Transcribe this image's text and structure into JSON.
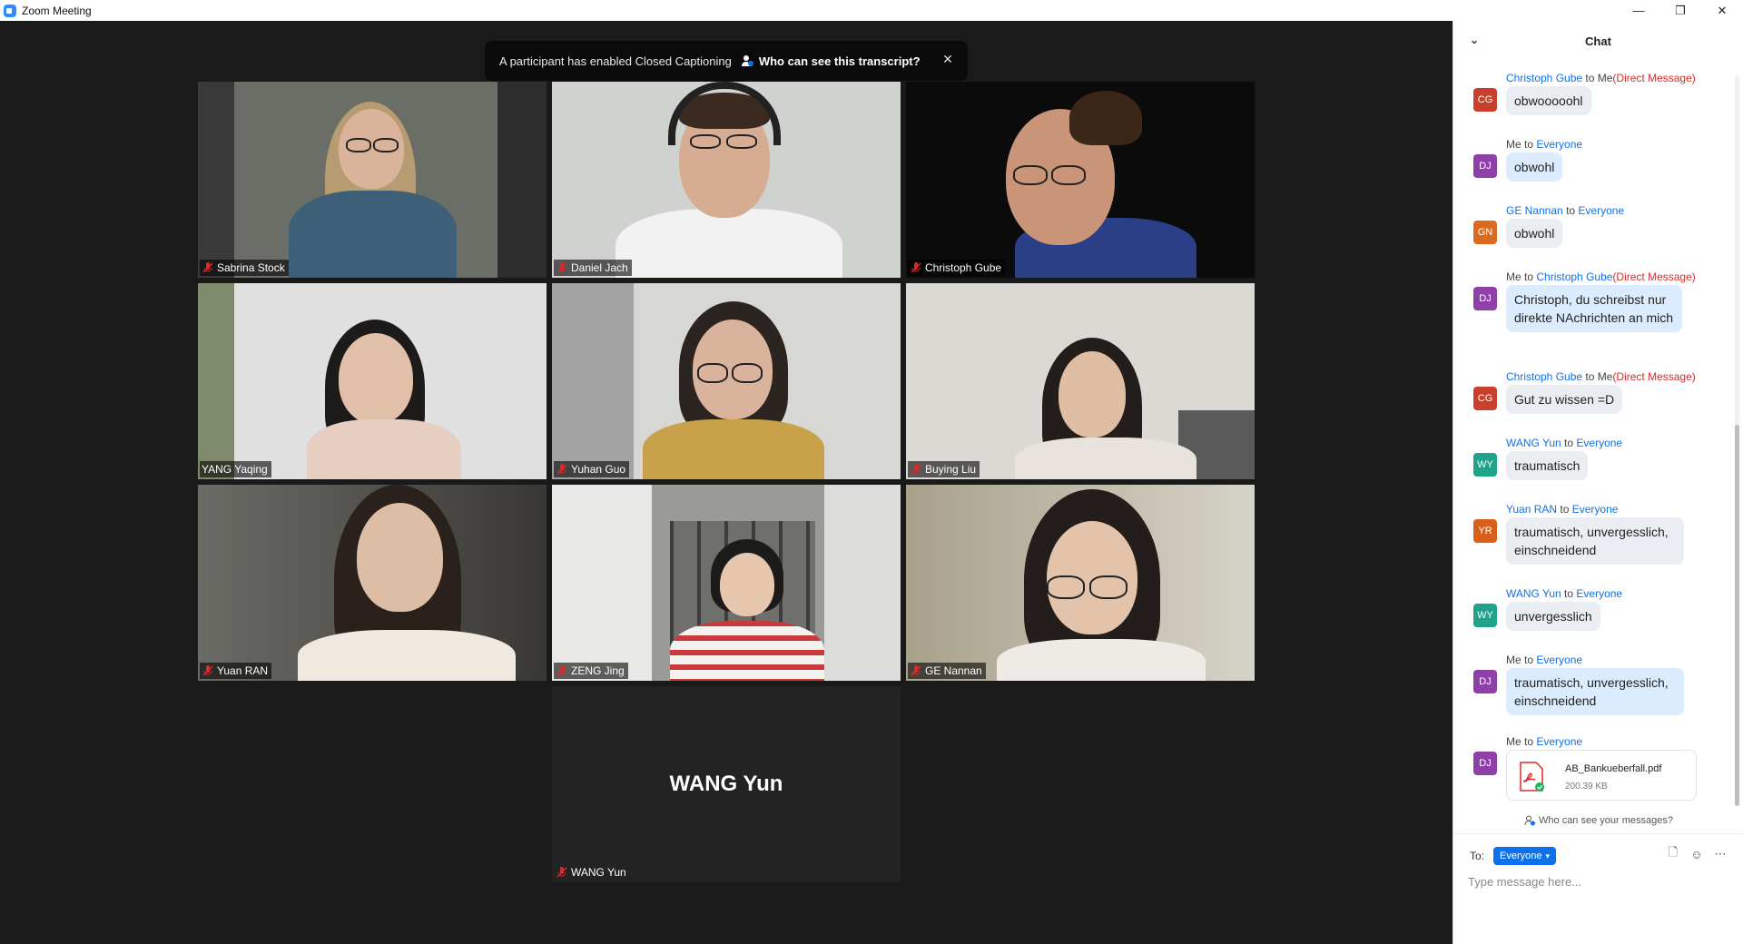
{
  "window": {
    "title": "Zoom Meeting",
    "minimize_glyph": "—",
    "maximize_glyph": "❐",
    "close_glyph": "✕"
  },
  "banner": {
    "text": "A participant has enabled Closed Captioning",
    "link": "Who can see this transcript?",
    "close_glyph": "✕"
  },
  "participants": [
    {
      "name": "Sabrina Stock"
    },
    {
      "name": "Daniel Jach"
    },
    {
      "name": "Christoph Gube"
    },
    {
      "name": "YANG Yaqing"
    },
    {
      "name": "Yuhan Guo"
    },
    {
      "name": "Buying Liu"
    },
    {
      "name": "Yuan RAN"
    },
    {
      "name": "ZENG Jing"
    },
    {
      "name": "GE Nannan"
    },
    {
      "name": "WANG Yun",
      "center_label": "WANG Yun"
    }
  ],
  "chat": {
    "title": "Chat",
    "messages": [
      {
        "from": "Christoph Gube",
        "to_word": "to",
        "to": "Me",
        "dm": "(Direct Message)",
        "initials": "CG",
        "avatar_color": "#c8402c",
        "text": "obwooooohl"
      },
      {
        "from": "Me",
        "to_word": "to",
        "to": "Everyone",
        "dm": "",
        "initials": "DJ",
        "avatar_color": "#8e3fa8",
        "text": "obwohl"
      },
      {
        "from": "GE Nannan",
        "to_word": "to",
        "to": "Everyone",
        "dm": "",
        "initials": "GN",
        "avatar_color": "#d96a1f",
        "text": "obwohl"
      },
      {
        "from": "Me",
        "to_word": "to",
        "to": "Christoph Gube",
        "dm": "(Direct Message)",
        "initials": "DJ",
        "avatar_color": "#8e3fa8",
        "text": "Christoph, du schreibst nur direkte NAchrichten an mich"
      },
      {
        "from": "Christoph Gube",
        "to_word": "to",
        "to": "Me",
        "dm": "(Direct Message)",
        "initials": "CG",
        "avatar_color": "#c8402c",
        "text": "Gut zu wissen =D"
      },
      {
        "from": "WANG Yun",
        "to_word": "to",
        "to": "Everyone",
        "dm": "",
        "initials": "WY",
        "avatar_color": "#1fa38a",
        "text": "traumatisch"
      },
      {
        "from": "Yuan RAN",
        "to_word": "to",
        "to": "Everyone",
        "dm": "",
        "initials": "YR",
        "avatar_color": "#d9601a",
        "text": "traumatisch, unvergesslich, einschneidend"
      },
      {
        "from": "WANG Yun",
        "to_word": "to",
        "to": "Everyone",
        "dm": "",
        "initials": "WY",
        "avatar_color": "#1fa38a",
        "text": "unvergesslich"
      },
      {
        "from": "Me",
        "to_word": "to",
        "to": "Everyone",
        "dm": "",
        "initials": "DJ",
        "avatar_color": "#8e3fa8",
        "text": "traumatisch, unvergesslich, einschneidend"
      },
      {
        "from": "Me",
        "to_word": "to",
        "to": "Everyone",
        "dm": "",
        "initials": "DJ",
        "avatar_color": "#8e3fa8",
        "file_name": "AB_Bankueberfall.pdf",
        "file_size": "200.39 KB"
      }
    ],
    "who_can_see": "Who can see your messages?",
    "to_label": "To:",
    "to_value": "Everyone",
    "input_placeholder": "Type message here..."
  },
  "colors": {
    "accent": "#0e71eb",
    "direct_message": "#e02828",
    "active_speaker": "#d9d95a"
  }
}
